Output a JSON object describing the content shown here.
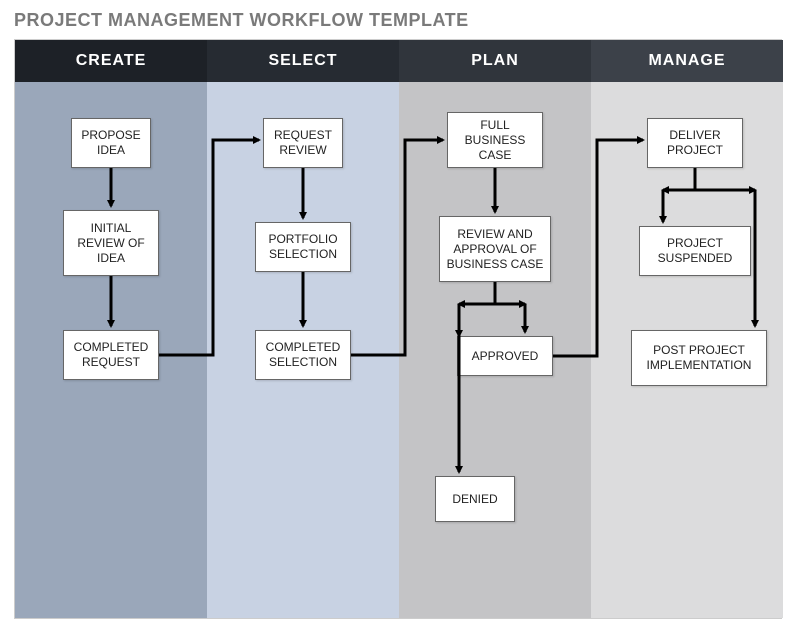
{
  "title": "PROJECT MANAGEMENT WORKFLOW TEMPLATE",
  "columns": {
    "create": {
      "label": "CREATE",
      "bg": "#9aa7ba",
      "header_bg": "#1d2127"
    },
    "select": {
      "label": "SELECT",
      "bg": "#c8d2e3",
      "header_bg": "#262b32"
    },
    "plan": {
      "label": "PLAN",
      "bg": "#c4c4c6",
      "header_bg": "#30353c"
    },
    "manage": {
      "label": "MANAGE",
      "bg": "#dcdcdd",
      "header_bg": "#3c4149"
    }
  },
  "boxes": {
    "propose_idea": "PROPOSE IDEA",
    "initial_review": "INITIAL REVIEW OF IDEA",
    "completed_request": "COMPLETED REQUEST",
    "request_review": "REQUEST REVIEW",
    "portfolio_selection": "PORTFOLIO SELECTION",
    "completed_selection": "COMPLETED SELECTION",
    "full_business_case": "FULL BUSINESS CASE",
    "review_approval": "REVIEW AND APPROVAL OF BUSINESS CASE",
    "approved": "APPROVED",
    "denied": "DENIED",
    "deliver_project": "DELIVER PROJECT",
    "project_suspended": "PROJECT SUSPENDED",
    "post_project_impl": "POST PROJECT IMPLEMENTATION"
  },
  "chart_data": {
    "type": "flowchart",
    "title": "PROJECT MANAGEMENT WORKFLOW TEMPLATE",
    "lanes": [
      "CREATE",
      "SELECT",
      "PLAN",
      "MANAGE"
    ],
    "nodes": [
      {
        "id": "propose_idea",
        "lane": "CREATE",
        "label": "PROPOSE IDEA"
      },
      {
        "id": "initial_review",
        "lane": "CREATE",
        "label": "INITIAL REVIEW OF IDEA"
      },
      {
        "id": "completed_request",
        "lane": "CREATE",
        "label": "COMPLETED REQUEST"
      },
      {
        "id": "request_review",
        "lane": "SELECT",
        "label": "REQUEST REVIEW"
      },
      {
        "id": "portfolio_selection",
        "lane": "SELECT",
        "label": "PORTFOLIO SELECTION"
      },
      {
        "id": "completed_selection",
        "lane": "SELECT",
        "label": "COMPLETED SELECTION"
      },
      {
        "id": "full_business_case",
        "lane": "PLAN",
        "label": "FULL BUSINESS CASE"
      },
      {
        "id": "review_approval",
        "lane": "PLAN",
        "label": "REVIEW AND APPROVAL OF BUSINESS CASE"
      },
      {
        "id": "approved",
        "lane": "PLAN",
        "label": "APPROVED"
      },
      {
        "id": "denied",
        "lane": "PLAN",
        "label": "DENIED"
      },
      {
        "id": "deliver_project",
        "lane": "MANAGE",
        "label": "DELIVER PROJECT"
      },
      {
        "id": "project_suspended",
        "lane": "MANAGE",
        "label": "PROJECT SUSPENDED"
      },
      {
        "id": "post_project_impl",
        "lane": "MANAGE",
        "label": "POST PROJECT IMPLEMENTATION"
      }
    ],
    "edges": [
      {
        "from": "propose_idea",
        "to": "initial_review"
      },
      {
        "from": "initial_review",
        "to": "completed_request"
      },
      {
        "from": "completed_request",
        "to": "request_review"
      },
      {
        "from": "request_review",
        "to": "portfolio_selection"
      },
      {
        "from": "portfolio_selection",
        "to": "completed_selection"
      },
      {
        "from": "completed_selection",
        "to": "full_business_case"
      },
      {
        "from": "full_business_case",
        "to": "review_approval"
      },
      {
        "from": "review_approval",
        "to": "approved"
      },
      {
        "from": "review_approval",
        "to": "denied"
      },
      {
        "from": "approved",
        "to": "deliver_project"
      },
      {
        "from": "deliver_project",
        "to": "project_suspended"
      },
      {
        "from": "deliver_project",
        "to": "post_project_impl"
      }
    ]
  }
}
